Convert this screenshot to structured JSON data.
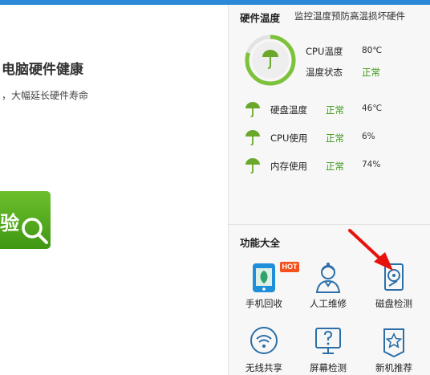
{
  "left": {
    "title": "电脑硬件健康",
    "subtitle": "，大幅延长硬件寿命",
    "check_button": "验"
  },
  "hardware": {
    "title": "硬件温度",
    "description": "监控温度预防高温损坏硬件",
    "gauge_level": 0.8,
    "cpu_temp_label": "CPU温度",
    "cpu_temp_value": "80℃",
    "temp_state_label": "温度状态",
    "temp_state_value": "正常",
    "rows": [
      {
        "name": "硬盘温度",
        "state": "正常",
        "value": "46℃"
      },
      {
        "name": "CPU使用",
        "state": "正常",
        "value": "6%"
      },
      {
        "name": "内存使用",
        "state": "正常",
        "value": "74%"
      }
    ],
    "green": "#3c9a16"
  },
  "functions": {
    "title": "功能大全",
    "hot_badge": "HOT",
    "tools": [
      {
        "label": "手机回收",
        "icon": "phone-recycle-icon"
      },
      {
        "label": "人工维修",
        "icon": "technician-icon"
      },
      {
        "label": "磁盘检测",
        "icon": "disk-check-icon"
      },
      {
        "label": "无线共享",
        "icon": "wifi-icon"
      },
      {
        "label": "屏幕检测",
        "icon": "screen-check-icon"
      },
      {
        "label": "新机推荐",
        "icon": "new-machine-star-icon"
      }
    ]
  },
  "colors": {
    "accent_blue": "#2b8ad8",
    "button_green": "#4fa81b",
    "annotation_red": "#e8120c"
  }
}
